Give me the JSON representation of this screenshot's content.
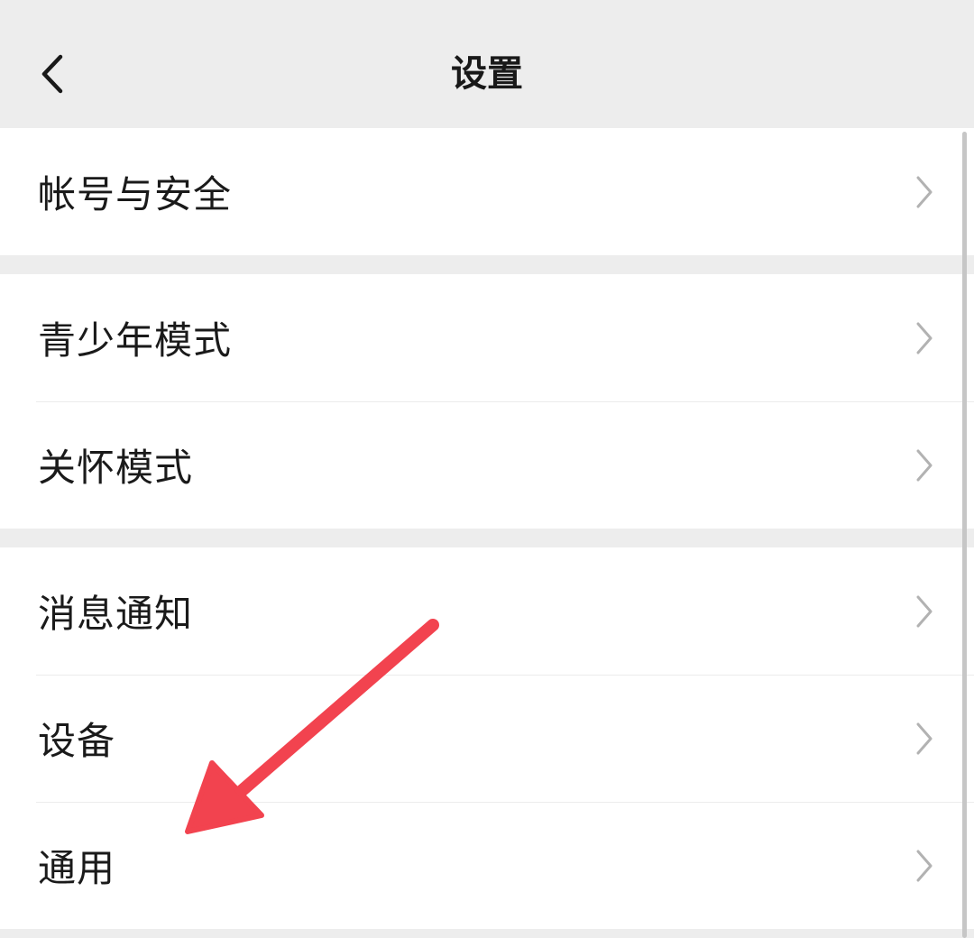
{
  "header": {
    "title": "设置",
    "back_icon": "chevron-left-icon"
  },
  "groups": [
    {
      "items": [
        {
          "label": "帐号与安全"
        }
      ]
    },
    {
      "items": [
        {
          "label": "青少年模式"
        },
        {
          "label": "关怀模式"
        }
      ]
    },
    {
      "items": [
        {
          "label": "消息通知"
        },
        {
          "label": "设备"
        },
        {
          "label": "通用"
        }
      ]
    }
  ],
  "colors": {
    "background": "#ededed",
    "card": "#ffffff",
    "text": "#1a1a1a",
    "chevron": "#b2b2b2",
    "annotation_arrow": "#f2434f"
  }
}
